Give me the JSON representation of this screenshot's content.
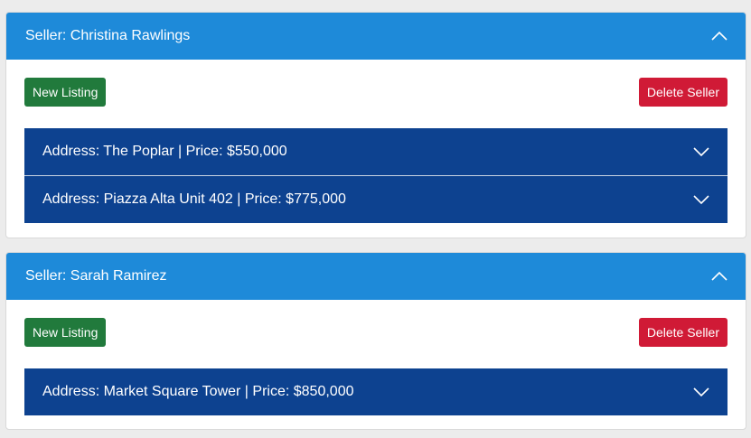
{
  "sellers": [
    {
      "header": "Seller: Christina Rawlings",
      "new_listing_label": "New Listing",
      "delete_label": "Delete Seller",
      "listings": [
        {
          "label": "Address: The Poplar | Price: $550,000"
        },
        {
          "label": "Address: Piazza Alta Unit 402 | Price: $775,000"
        }
      ]
    },
    {
      "header": "Seller: Sarah Ramirez",
      "new_listing_label": "New Listing",
      "delete_label": "Delete Seller",
      "listings": [
        {
          "label": "Address: Market Square Tower | Price: $850,000"
        }
      ]
    }
  ],
  "icons": {
    "seller_toggle": "chevron-up-icon",
    "listing_toggle": "chevron-down-icon"
  },
  "colors": {
    "page_bg": "#ececec",
    "seller_header": "#1e8ad9",
    "listing_bg": "#0d4290",
    "new_listing": "#217a3c",
    "delete_seller": "#d01a36"
  }
}
